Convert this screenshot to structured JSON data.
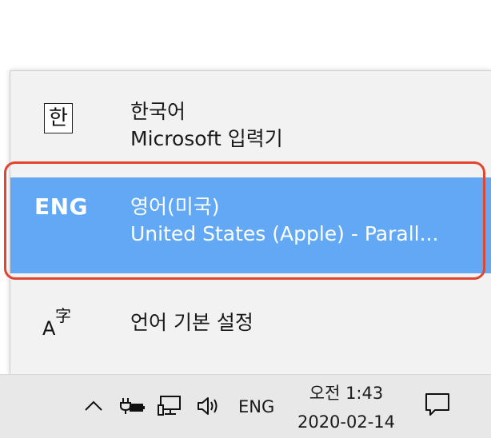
{
  "flyout": {
    "items": [
      {
        "icon_text": "한",
        "title": "한국어",
        "subtitle": "Microsoft 입력기",
        "selected": false
      },
      {
        "icon_text": "ENG",
        "title": "영어(미국)",
        "subtitle": "United States (Apple) - Parall...",
        "selected": true
      },
      {
        "icon_text_a": "A",
        "icon_text_ji": "字",
        "title": "언어 기본 설정"
      }
    ],
    "selected_color": "#62a8f5",
    "highlight_color": "#e0452f"
  },
  "taskbar": {
    "tray_icons": [
      "chevron-up-icon",
      "battery-plug-icon",
      "network-icon",
      "volume-icon"
    ],
    "input_indicator": "ENG",
    "clock_time": "오전 1:43",
    "clock_date": "2020-02-14",
    "notification_icon": "action-center-icon"
  }
}
